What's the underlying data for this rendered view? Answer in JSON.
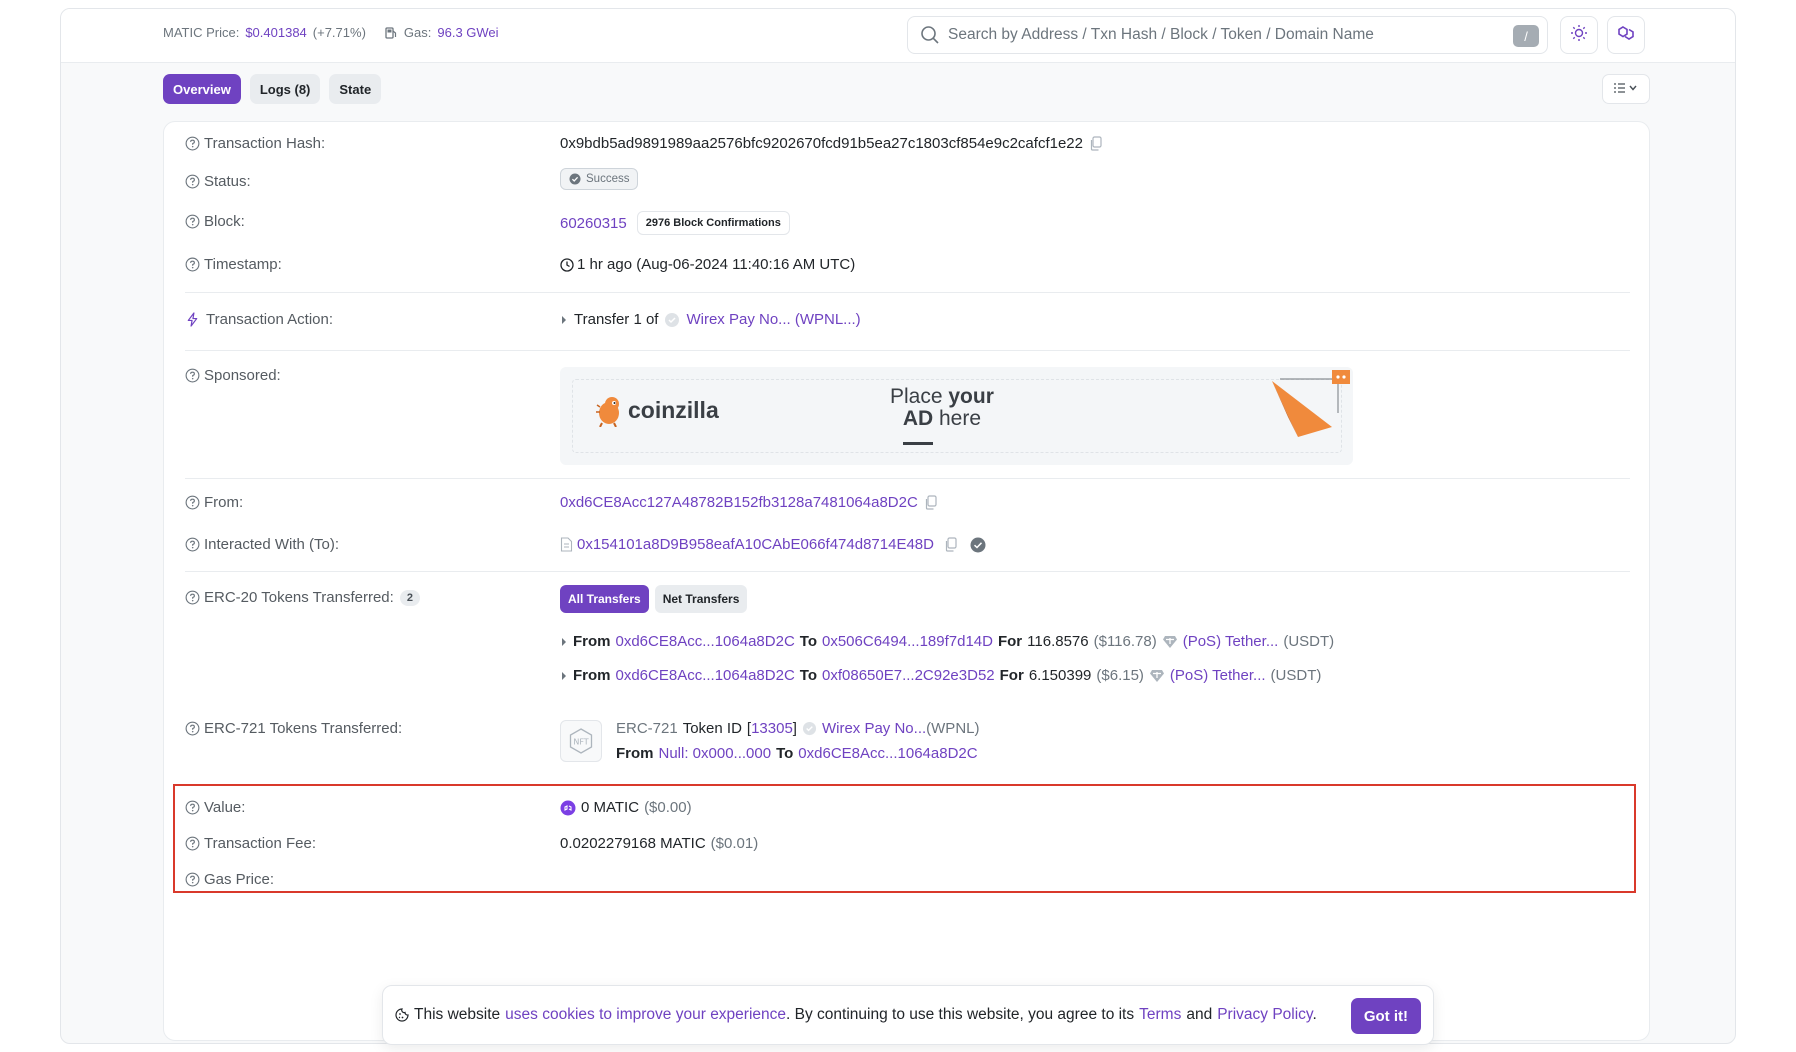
{
  "topbar": {
    "matic_label": "MATIC Price:",
    "matic_price": "$0.401384",
    "matic_change": "(+7.71%)",
    "gas_label": "Gas:",
    "gas_value": "96.3 GWei",
    "search_placeholder": "Search by Address / Txn Hash / Block / Token / Domain Name",
    "slash_key": "/"
  },
  "tabs": [
    {
      "label": "Overview"
    },
    {
      "label": "Logs (8)"
    },
    {
      "label": "State"
    }
  ],
  "tx": {
    "hash_label": "Transaction Hash:",
    "hash": "0x9bdb5ad9891989aa2576bfc9202670fcd91b5ea27c1803cf854e9c2cafcf1e22",
    "status_label": "Status:",
    "status": "Success",
    "block_label": "Block:",
    "block": "60260315",
    "confirmations": "2976 Block Confirmations",
    "timestamp_label": "Timestamp:",
    "timestamp": "1 hr ago (Aug-06-2024 11:40:16 AM UTC)",
    "action_label": "Transaction Action:",
    "action_prefix": "Transfer 1 of",
    "action_token": "Wirex Pay No... (WPNL...)",
    "sponsored_label": "Sponsored:",
    "ad_brand": "coinzilla",
    "ad_line1a": "Place ",
    "ad_line1b": "your",
    "ad_line2a": "AD",
    "ad_line2b": " here",
    "from_label": "From:",
    "from": "0xd6CE8Acc127A48782B152fb3128a7481064a8D2C",
    "to_label": "Interacted With (To):",
    "to": "0x154101a8D9B958eafA10CAbE066f474d8714E48D",
    "erc20_label": "ERC-20 Tokens Transferred:",
    "erc20_count": "2",
    "erc20_tab_all": "All Transfers",
    "erc20_tab_net": "Net Transfers",
    "erc20_transfers": [
      {
        "from_word": "From",
        "from": "0xd6CE8Acc...1064a8D2C",
        "to_word": "To",
        "to": "0x506C6494...189f7d14D",
        "for_word": "For",
        "amount": "116.8576",
        "usd": "($116.78)",
        "token": "(PoS) Tether...",
        "symbol": "(USDT)"
      },
      {
        "from_word": "From",
        "from": "0xd6CE8Acc...1064a8D2C",
        "to_word": "To",
        "to": "0xf08650E7...2C92e3D52",
        "for_word": "For",
        "amount": "6.150399",
        "usd": "($6.15)",
        "token": "(PoS) Tether...",
        "symbol": "(USDT)"
      }
    ],
    "erc721_label": "ERC-721 Tokens Transferred:",
    "erc721_type": "ERC-721",
    "erc721_tokenid_word": "Token ID",
    "erc721_tokenid": "13305",
    "erc721_token": "Wirex Pay No...",
    "erc721_symbol": "(WPNL)",
    "erc721_from_word": "From",
    "erc721_from": "Null: 0x000...000",
    "erc721_to_word": "To",
    "erc721_to": "0xd6CE8Acc...1064a8D2C",
    "value_label": "Value:",
    "value": "0 MATIC",
    "value_usd": "($0.00)",
    "fee_label": "Transaction Fee:",
    "fee": "0.0202279168 MATIC",
    "fee_usd": "($0.01)",
    "gas_price_label": "Gas Price:"
  },
  "cookie": {
    "text1": "This website",
    "link1": "uses cookies to improve your experience",
    "text2": ". By continuing to use this website, you agree to its",
    "terms": "Terms",
    "and": "and",
    "privacy": "Privacy Policy",
    "dot": ".",
    "button": "Got it!"
  },
  "colors": {
    "accent": "#6f42c1",
    "highlight": "#d9392b"
  }
}
